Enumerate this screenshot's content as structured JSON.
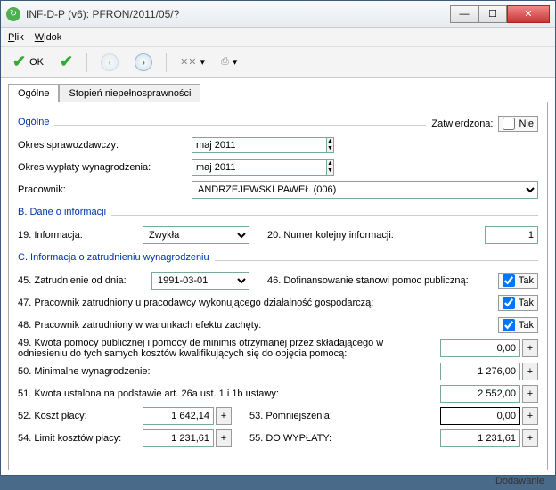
{
  "window": {
    "title": "INF-D-P (v6): PFRON/2011/05/?"
  },
  "menu": {
    "file": "Plik",
    "view": "Widok"
  },
  "toolbar": {
    "ok": "OK"
  },
  "tabs": {
    "general": "Ogólne",
    "disability": "Stopień niepełnosprawności"
  },
  "sectionA": {
    "title": "Ogólne",
    "approved_label": "Zatwierdzona:",
    "approved_value": "Nie",
    "period_label": "Okres sprawozdawczy:",
    "period_value": "maj 2011",
    "pay_period_label": "Okres wypłaty wynagrodzenia:",
    "pay_period_value": "maj 2011",
    "employee_label": "Pracownik:",
    "employee_value": "ANDRZEJEWSKI PAWEŁ (006)"
  },
  "sectionB": {
    "title": "B. Dane o informacji",
    "info_label": "19. Informacja:",
    "info_value": "Zwykła",
    "seq_label": "20. Numer kolejny informacji:",
    "seq_value": "1"
  },
  "sectionC": {
    "title": "C. Informacja o zatrudnieniu wynagrodzeniu",
    "f45_label": "45. Zatrudnienie od dnia:",
    "f45_value": "1991-03-01",
    "f46_label": "46. Dofinansowanie stanowi pomoc publiczną:",
    "f46_value": "Tak",
    "f47_label": "47. Pracownik zatrudniony u pracodawcy wykonującego działalność gospodarczą:",
    "f47_value": "Tak",
    "f48_label": "48. Pracownik zatrudniony w warunkach efektu zachęty:",
    "f48_value": "Tak",
    "f49_label": "49. Kwota pomocy publicznej i pomocy de minimis otrzymanej przez składającego w odniesieniu do tych samych kosztów kwalifikujących się do objęcia pomocą:",
    "f49_value": "0,00",
    "f50_label": "50. Minimalne wynagrodzenie:",
    "f50_value": "1 276,00",
    "f51_label": "51. Kwota ustalona na podstawie art. 26a ust. 1 i 1b ustawy:",
    "f51_value": "2 552,00",
    "f52_label": "52. Koszt płacy:",
    "f52_value": "1 642,14",
    "f53_label": "53. Pomniejszenia:",
    "f53_value": "0,00",
    "f54_label": "54. Limit kosztów płacy:",
    "f54_value": "1 231,61",
    "f55_label": "55. DO WYPŁATY:",
    "f55_value": "1 231,61"
  },
  "status": "Dodawanie"
}
